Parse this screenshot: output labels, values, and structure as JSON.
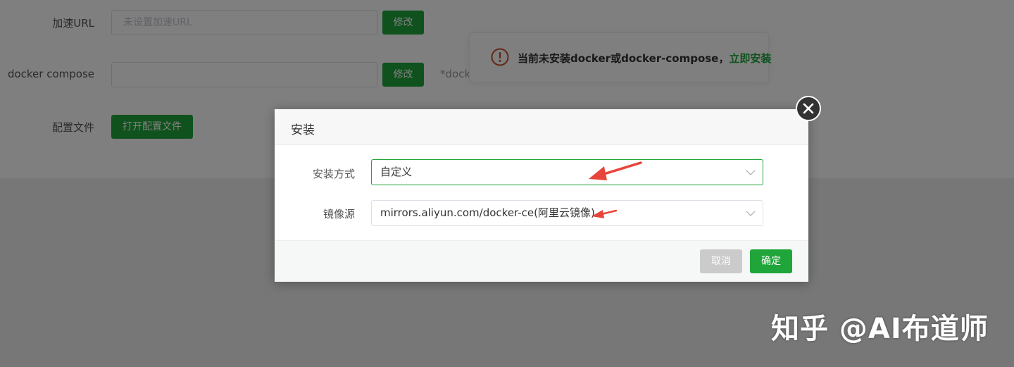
{
  "settings": {
    "accel_url": {
      "label": "加速URL",
      "placeholder": "未设置加速URL",
      "button": "修改"
    },
    "docker_compose": {
      "label": "docker compose",
      "value": "",
      "button": "修改",
      "hint": "*dock"
    },
    "config_file": {
      "label": "配置文件",
      "button": "打开配置文件"
    }
  },
  "alert": {
    "message": "当前未安装docker或docker-compose，",
    "link": "立即安装",
    "icon": "warning-circle-icon",
    "color": "#c9502a"
  },
  "dialog": {
    "title": "安装",
    "fields": [
      {
        "label": "安装方式",
        "value": "自定义"
      },
      {
        "label": "镜像源",
        "value": "mirrors.aliyun.com/docker-ce(阿里云镜像)"
      }
    ],
    "cancel_label": "取消",
    "confirm_label": "确定"
  },
  "watermark": "知乎 @AI布道师",
  "colors": {
    "accent": "#20a53a",
    "annotation_arrow": "#e8443a",
    "overlay": "rgba(0,0,0,0.5)"
  }
}
